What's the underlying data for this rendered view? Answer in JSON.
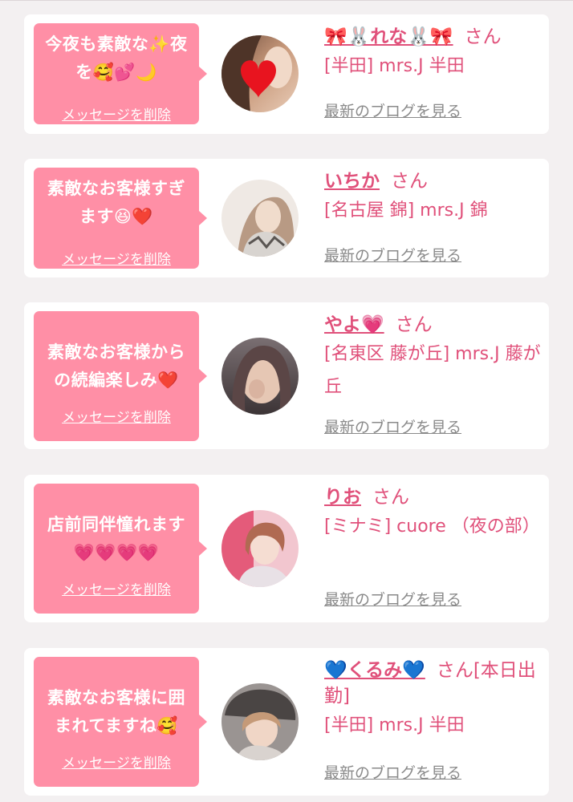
{
  "delete_label": "メッセージを削除",
  "blog_label": "最新のブログを見る",
  "colors": {
    "bubble": "#ff8fa6",
    "name": "#e0507a",
    "link_gray": "#8a8a8a",
    "page_bg": "#f3f0f1"
  },
  "cards": [
    {
      "message": "今夜も素敵な✨夜\nを🥰💕🌙",
      "name": "🎀🐰れな🐰🎀",
      "san": "さん",
      "shop": "[半田] mrs.J 半田",
      "avatar_icon": "heart-photo"
    },
    {
      "message": "素敵なお客様すぎ\nます😆❤️",
      "name": "いちか",
      "san": "さん",
      "shop": "[名古屋 錦] mrs.J 錦",
      "avatar_icon": "photo"
    },
    {
      "message": "素敵なお客様から\nの続編楽しみ❤️",
      "name": "やよ💗",
      "san": "さん",
      "shop": "[名東区 藤が丘] mrs.J 藤が丘",
      "avatar_icon": "photo"
    },
    {
      "message": "店前同伴憧れます\n💗💗💗💗",
      "name": "りお",
      "san": "さん",
      "shop": "[ミナミ] cuore （夜の部）",
      "avatar_icon": "photo"
    },
    {
      "message": "素敵なお客様に囲\nまれてますね🥰",
      "name": "💙くるみ💙",
      "san": "さん[本日出勤]",
      "shop": "[半田] mrs.J 半田",
      "avatar_icon": "photo"
    }
  ]
}
